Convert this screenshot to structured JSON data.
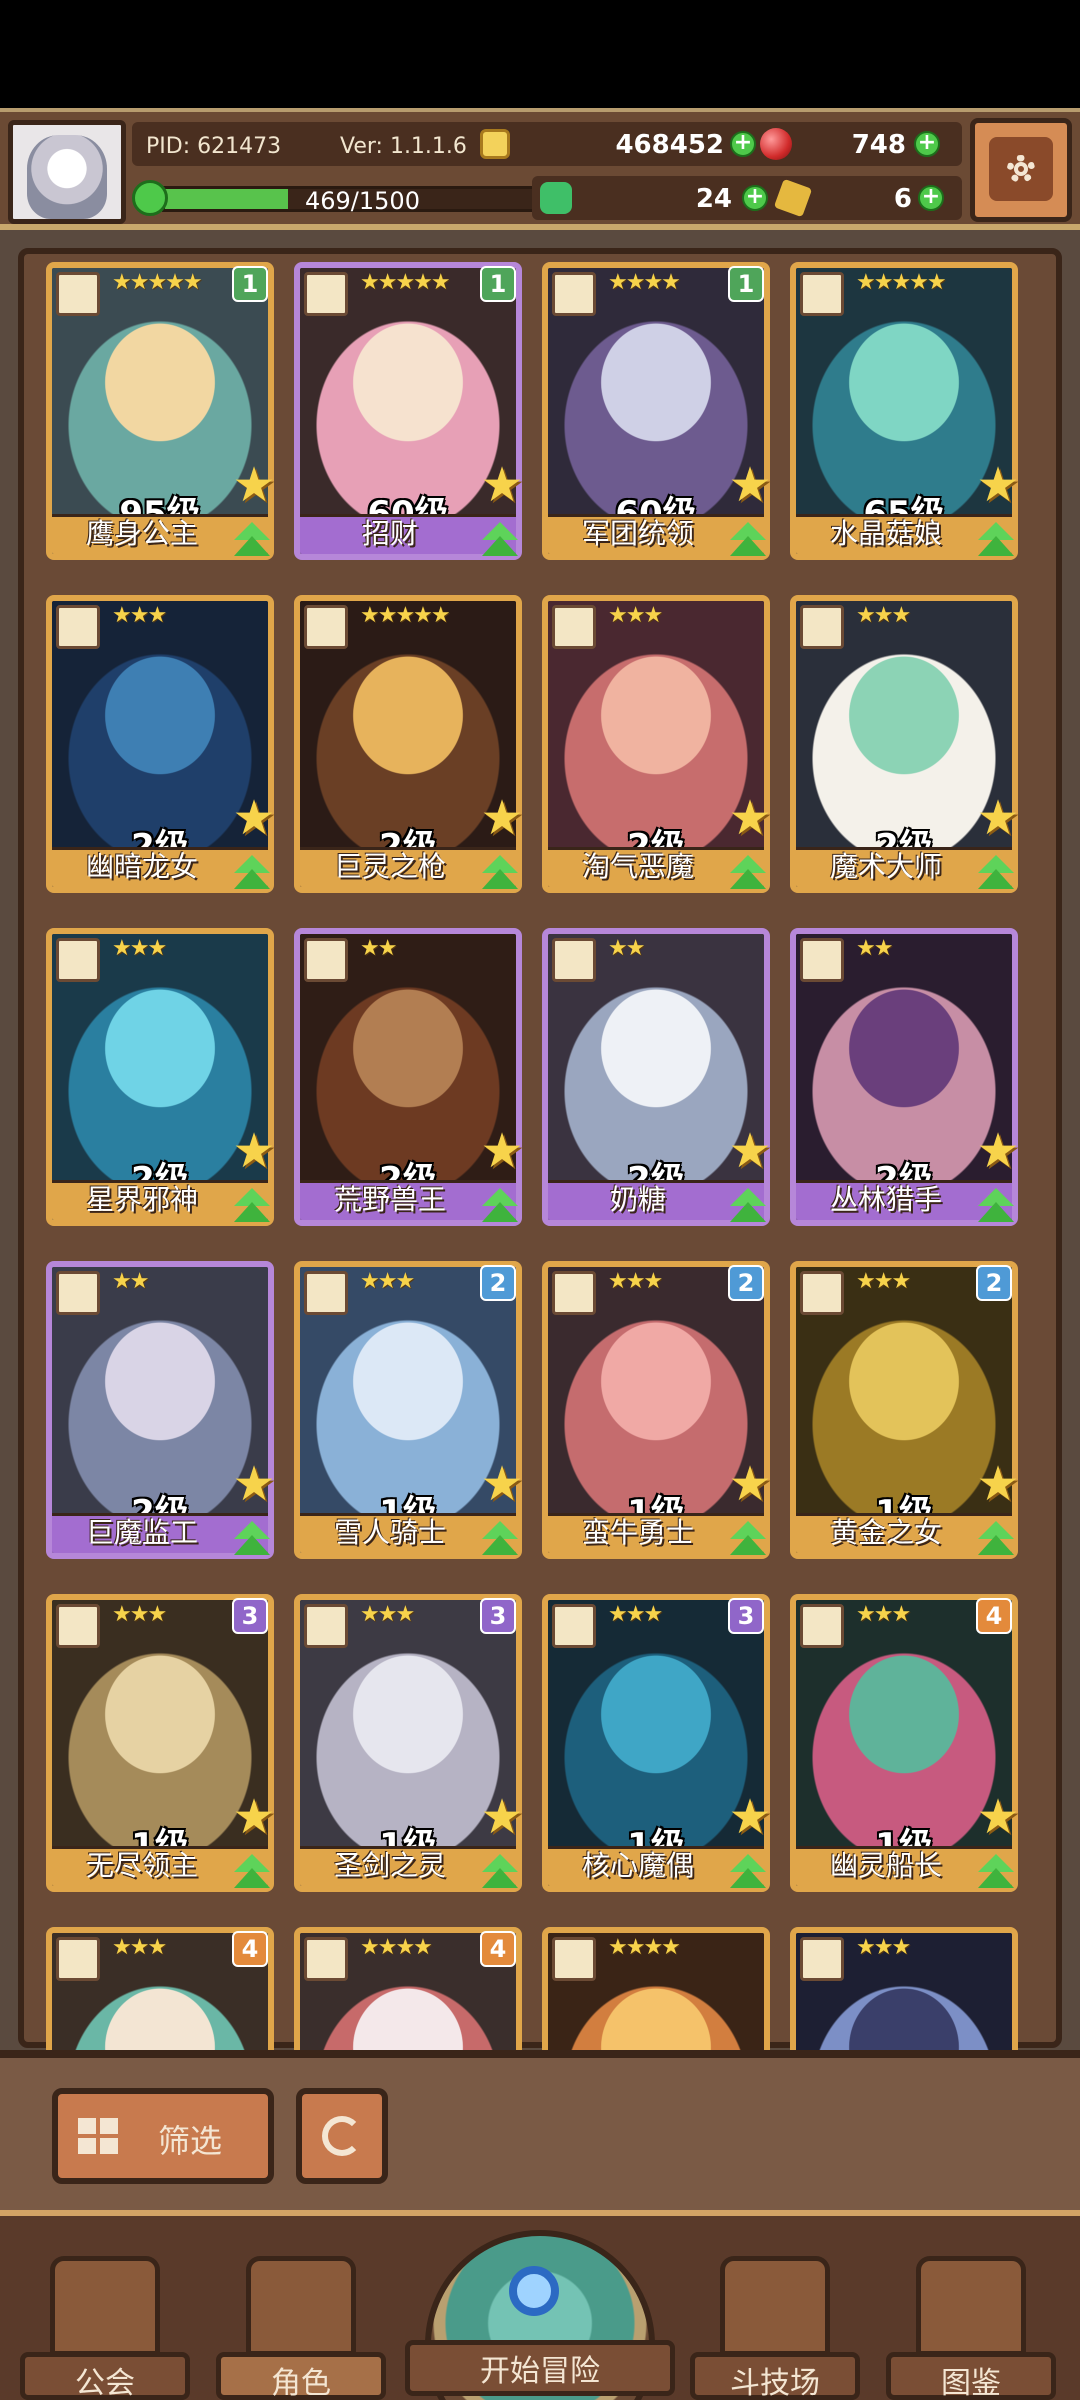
{
  "hud": {
    "pid": "PID: 621473",
    "version": "Ver: 1.1.1.6",
    "gold": "468452",
    "gems": "748",
    "xp_text": "469/1500",
    "xp_fraction": 0.3127,
    "clover": "24",
    "keys": "6",
    "icons": {
      "avatar": "player-avatar",
      "gold": "coin-icon",
      "gems": "red-gem-icon",
      "xp": "xp-icon",
      "clover": "clover-icon",
      "keys": "key-icon",
      "settings": "gear-icon"
    }
  },
  "cards": [
    {
      "name": "鹰身公主",
      "level": "95级",
      "stars": "★★★★★",
      "badge": "1",
      "badge_color": "green",
      "frame": "gold"
    },
    {
      "name": "招财",
      "level": "60级",
      "stars": "★★★★★",
      "badge": "1",
      "badge_color": "green",
      "frame": "purple"
    },
    {
      "name": "军团统领",
      "level": "60级",
      "stars": "★★★★",
      "badge": "1",
      "badge_color": "green",
      "frame": "gold"
    },
    {
      "name": "水晶菇娘",
      "level": "65级",
      "stars": "★★★★★",
      "badge": "",
      "badge_color": "",
      "frame": "gold"
    },
    {
      "name": "幽暗龙女",
      "level": "2级",
      "stars": "★★★",
      "badge": "",
      "badge_color": "",
      "frame": "gold"
    },
    {
      "name": "巨灵之枪",
      "level": "2级",
      "stars": "★★★★★",
      "badge": "",
      "badge_color": "",
      "frame": "gold"
    },
    {
      "name": "淘气恶魔",
      "level": "2级",
      "stars": "★★★",
      "badge": "",
      "badge_color": "",
      "frame": "gold"
    },
    {
      "name": "魔术大师",
      "level": "2级",
      "stars": "★★★",
      "badge": "",
      "badge_color": "",
      "frame": "gold"
    },
    {
      "name": "星界邪神",
      "level": "2级",
      "stars": "★★★",
      "badge": "",
      "badge_color": "",
      "frame": "gold"
    },
    {
      "name": "荒野兽王",
      "level": "2级",
      "stars": "★★",
      "badge": "",
      "badge_color": "",
      "frame": "purple"
    },
    {
      "name": "奶糖",
      "level": "2级",
      "stars": "★★",
      "badge": "",
      "badge_color": "",
      "frame": "purple"
    },
    {
      "name": "丛林猎手",
      "level": "2级",
      "stars": "★★",
      "badge": "",
      "badge_color": "",
      "frame": "purple"
    },
    {
      "name": "巨魔监工",
      "level": "2级",
      "stars": "★★",
      "badge": "",
      "badge_color": "",
      "frame": "purple"
    },
    {
      "name": "雪人骑士",
      "level": "1级",
      "stars": "★★★",
      "badge": "2",
      "badge_color": "blue",
      "frame": "gold"
    },
    {
      "name": "蛮牛勇士",
      "level": "1级",
      "stars": "★★★",
      "badge": "2",
      "badge_color": "blue",
      "frame": "gold"
    },
    {
      "name": "黄金之女",
      "level": "1级",
      "stars": "★★★",
      "badge": "2",
      "badge_color": "blue",
      "frame": "gold"
    },
    {
      "name": "无尽领主",
      "level": "1级",
      "stars": "★★★",
      "badge": "3",
      "badge_color": "purple",
      "frame": "gold"
    },
    {
      "name": "圣剑之灵",
      "level": "1级",
      "stars": "★★★",
      "badge": "3",
      "badge_color": "purple",
      "frame": "gold"
    },
    {
      "name": "核心魔偶",
      "level": "1级",
      "stars": "★★★",
      "badge": "3",
      "badge_color": "purple",
      "frame": "gold"
    },
    {
      "name": "幽灵船长",
      "level": "1级",
      "stars": "★★★",
      "badge": "4",
      "badge_color": "orange",
      "frame": "gold"
    },
    {
      "name": "",
      "level": "",
      "stars": "★★★",
      "badge": "4",
      "badge_color": "orange",
      "frame": "gold"
    },
    {
      "name": "",
      "level": "",
      "stars": "★★★★",
      "badge": "4",
      "badge_color": "orange",
      "frame": "gold"
    },
    {
      "name": "",
      "level": "",
      "stars": "★★★★",
      "badge": "",
      "badge_color": "",
      "frame": "gold"
    },
    {
      "name": "",
      "level": "",
      "stars": "★★★",
      "badge": "",
      "badge_color": "",
      "frame": "gold"
    }
  ],
  "controls": {
    "filter_label": "筛选",
    "filter_icon": "grid-icon",
    "reset_icon": "refresh-icon"
  },
  "nav": {
    "guild": "公会",
    "role": "角色",
    "adventure": "开始冒险",
    "arena": "斗技场",
    "codex": "图鉴"
  },
  "colors": {
    "gold_frame": "#e0a64a",
    "purple_frame": "#b687d9",
    "panel_brown": "#6b4a34",
    "upgrade_green": "#5ed35a",
    "star_yellow": "#f7d34b"
  }
}
